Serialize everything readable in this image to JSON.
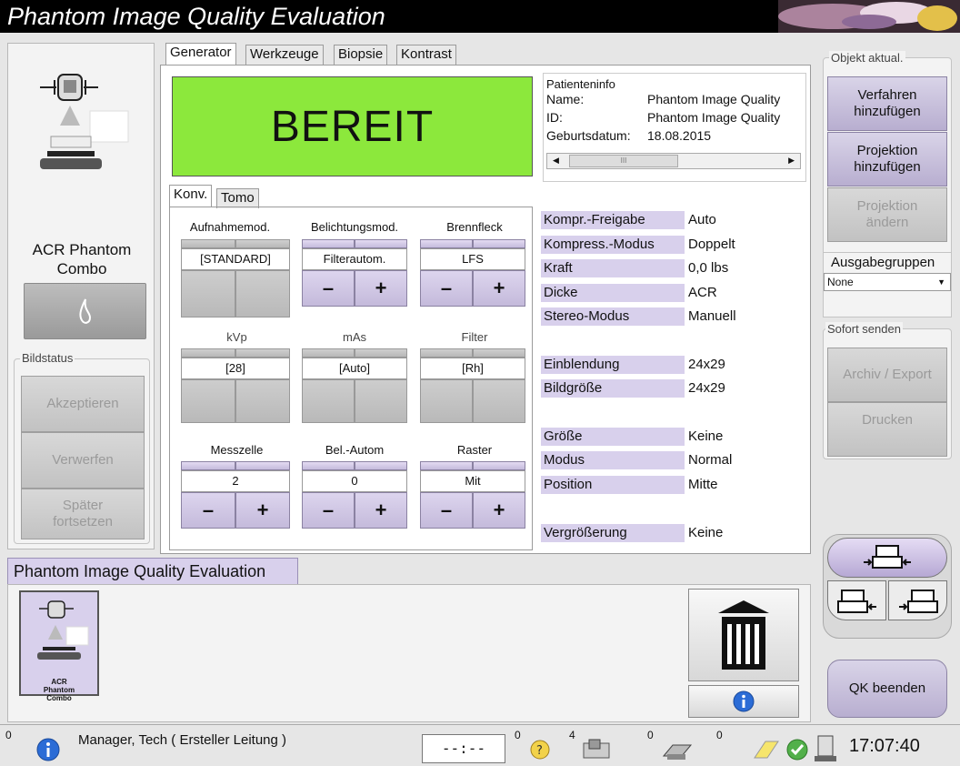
{
  "app": {
    "title": "Phantom Image Quality Evaluation"
  },
  "left": {
    "procedure_name": "ACR Phantom Combo",
    "bildstatus_legend": "Bildstatus",
    "buttons": {
      "accept": "Akzeptieren",
      "reject": "Verwerfen",
      "later": "Später fortsetzen"
    }
  },
  "tabs": {
    "generator": "Generator",
    "werkzeuge": "Werkzeuge",
    "biopsie": "Biopsie",
    "kontrast": "Kontrast"
  },
  "ready_text": "BEREIT",
  "patient": {
    "legend": "Patienteninfo",
    "name_label": "Name:",
    "name_value": "Phantom Image Quality",
    "id_label": "ID:",
    "id_value": "Phantom Image Quality",
    "dob_label": "Geburtsdatum:",
    "dob_value": "18.08.2015",
    "scroll_glyph": "III"
  },
  "subtabs": {
    "konv": "Konv.",
    "tomo": "Tomo"
  },
  "controls": {
    "aufnahmemod": {
      "label": "Aufnahmemod.",
      "value": "[STANDARD]"
    },
    "belichtungsmod": {
      "label": "Belichtungsmod.",
      "value": "Filterautom."
    },
    "brennfleck": {
      "label": "Brennfleck",
      "value": "LFS"
    },
    "kvp": {
      "label": "kVp",
      "value": "[28]"
    },
    "mas": {
      "label": "mAs",
      "value": "[Auto]"
    },
    "filter": {
      "label": "Filter",
      "value": "[Rh]"
    },
    "messzelle": {
      "label": "Messzelle",
      "value": "2"
    },
    "belautom": {
      "label": "Bel.-Autom",
      "value": "0"
    },
    "raster": {
      "label": "Raster",
      "value": "Mit"
    },
    "minus": "–",
    "plus": "+"
  },
  "props": [
    {
      "label": "Kompr.-Freigabe",
      "value": "Auto"
    },
    {
      "label": "Kompress.-Modus",
      "value": "Doppelt"
    },
    {
      "label": "Kraft",
      "value": "0,0 lbs"
    },
    {
      "label": "Dicke",
      "value": "ACR"
    },
    {
      "label": "Stereo-Modus",
      "value": "Manuell"
    },
    {
      "label": "Einblendung",
      "value": "24x29"
    },
    {
      "label": "Bildgröße",
      "value": "24x29"
    },
    {
      "label": "Größe",
      "value": "Keine"
    },
    {
      "label": "Modus",
      "value": "Normal"
    },
    {
      "label": "Position",
      "value": "Mitte"
    },
    {
      "label": "Vergrößerung",
      "value": "Keine"
    }
  ],
  "right": {
    "objekt_legend": "Objekt aktual.",
    "verfahren": "Verfahren hinzufügen",
    "projektion_add": "Projektion hinzufügen",
    "projektion_change": "Projektion ändern",
    "ausgabe_legend": "Ausgabegruppen",
    "ausgabe_value": "None",
    "sofort_legend": "Sofort senden",
    "archiv": "Archiv / Export",
    "drucken": "Drucken",
    "qk_beenden": "QK beenden"
  },
  "bottom": {
    "procedure_tab": "Phantom Image Quality Evaluation",
    "thumb_label": "ACR Phantom Combo"
  },
  "status": {
    "info_count": "0",
    "user": "Manager, Tech ( Ersteller Leitung )",
    "timer": "--:--",
    "c1": "0",
    "c2": "4",
    "c3": "0",
    "c4": "0",
    "clock": "17:07:40"
  },
  "colors": {
    "ready_green": "#8ce83c",
    "accent_purple": "#d8d0ec"
  }
}
